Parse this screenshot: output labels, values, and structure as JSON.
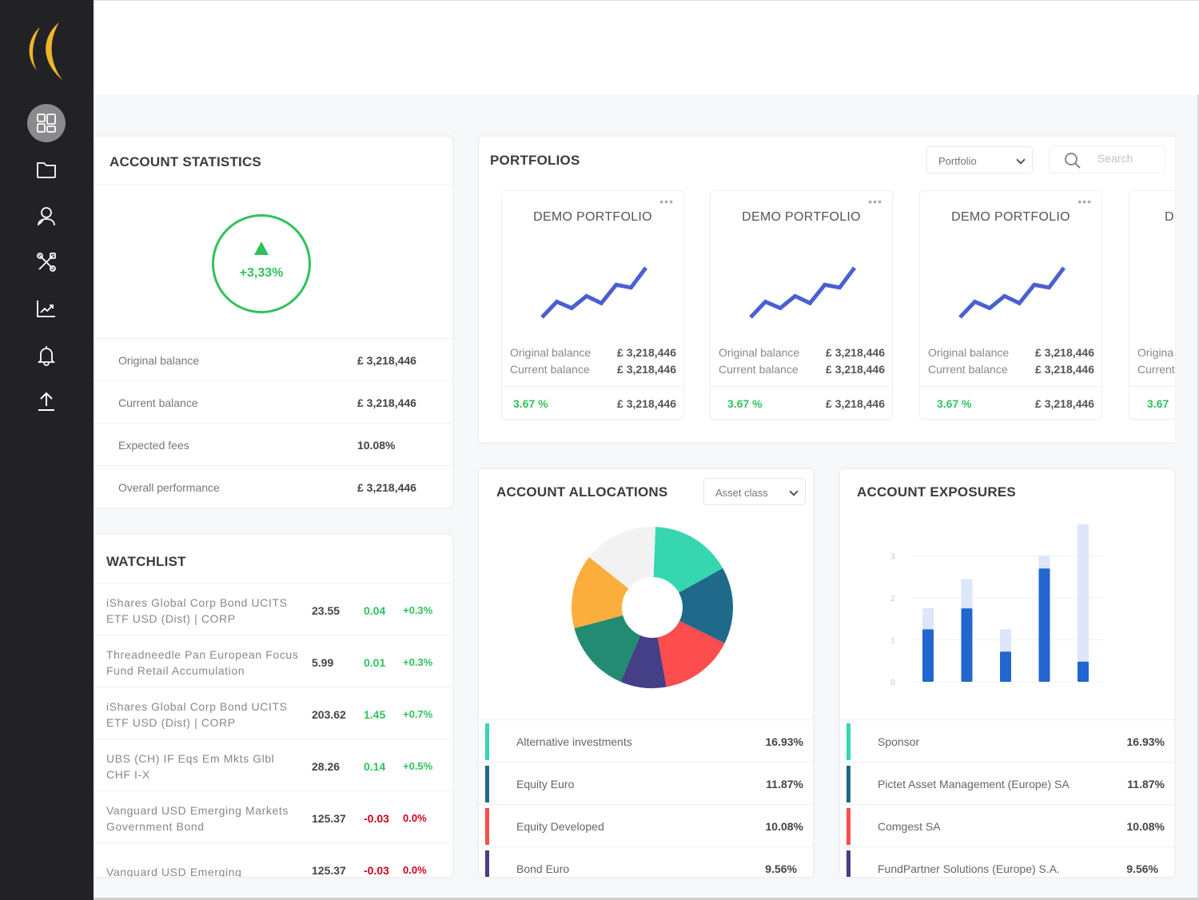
{
  "sidebar": {
    "logo": "brand-logo",
    "items": [
      {
        "name": "dashboard",
        "icon": "dashboard-icon",
        "active": true
      },
      {
        "name": "folder",
        "icon": "folder-icon",
        "active": false
      },
      {
        "name": "clients",
        "icon": "user-icon",
        "active": false
      },
      {
        "name": "tools",
        "icon": "tools-icon",
        "active": false
      },
      {
        "name": "analytics",
        "icon": "chart-icon",
        "active": false
      },
      {
        "name": "notifications",
        "icon": "bell-icon",
        "active": false
      },
      {
        "name": "upload",
        "icon": "upload-icon",
        "active": false
      }
    ]
  },
  "colors": {
    "green": "#2fc25b",
    "red": "#d0021b",
    "sparkline": "#4a5fd1",
    "bar_dark": "#2266d0",
    "bar_light": "#dde6fa",
    "sidebar_bg": "#222226",
    "logo": "#f0b428"
  },
  "account_statistics": {
    "title": "ACCOUNT STATISTICS",
    "performance": "+3,33%",
    "rows": [
      {
        "label": "Original balance",
        "value": "£ 3,218,446"
      },
      {
        "label": "Current balance",
        "value": "£ 3,218,446"
      },
      {
        "label": "Expected fees",
        "value": "10.08%"
      },
      {
        "label": "Overall performance",
        "value": "£ 3,218,446"
      }
    ]
  },
  "watchlist": {
    "title": "WATCHLIST",
    "rows": [
      {
        "name": "iShares Global Corp Bond UCITS ETF USD (Dist) | CORP",
        "price": "23.55",
        "change": "0.04",
        "pct": "+0.3%",
        "dir": "up"
      },
      {
        "name": "Threadneedle Pan European Focus Fund Retail Accumulation",
        "price": "5.99",
        "change": "0.01",
        "pct": "+0.3%",
        "dir": "up"
      },
      {
        "name": "iShares Global Corp Bond UCITS ETF USD (Dist) | CORP",
        "price": "203.62",
        "change": "1.45",
        "pct": "+0.7%",
        "dir": "up"
      },
      {
        "name": "UBS (CH) IF Eqs Em Mkts Glbl CHF I-X",
        "price": "28.26",
        "change": "0.14",
        "pct": "+0.5%",
        "dir": "up"
      },
      {
        "name": "Vanguard USD Emerging Markets Government Bond",
        "price": "125.37",
        "change": "-0.03",
        "pct": "0.0%",
        "dir": "down"
      },
      {
        "name": "Vanguard USD Emerging",
        "price": "125.37",
        "change": "-0.03",
        "pct": "0.0%",
        "dir": "down"
      }
    ]
  },
  "portfolios": {
    "title": "PORTFOLIOS",
    "filter": {
      "selected": "Portfolio"
    },
    "search": {
      "placeholder": "Search",
      "value": ""
    },
    "cards": [
      {
        "title": "DEMO PORTFOLIO",
        "original_label": "Original balance",
        "original": "£ 3,218,446",
        "current_label": "Current balance",
        "current": "£ 3,218,446",
        "pct": "3.67 %",
        "total": "£ 3,218,446",
        "trend": [
          0,
          2.2,
          1.3,
          3.0,
          2.0,
          4.6,
          4.2,
          7.0
        ]
      },
      {
        "title": "DEMO PORTFOLIO",
        "original_label": "Original balance",
        "original": "£ 3,218,446",
        "current_label": "Current balance",
        "current": "£ 3,218,446",
        "pct": "3.67 %",
        "total": "£ 3,218,446",
        "trend": [
          0,
          2.2,
          1.3,
          3.0,
          2.0,
          4.6,
          4.2,
          7.0
        ]
      },
      {
        "title": "DEMO PORTFOLIO",
        "original_label": "Original balance",
        "original": "£ 3,218,446",
        "current_label": "Current balance",
        "current": "£ 3,218,446",
        "pct": "3.67 %",
        "total": "£ 3,218,446",
        "trend": [
          0,
          2.2,
          1.3,
          3.0,
          2.0,
          4.6,
          4.2,
          7.0
        ]
      },
      {
        "title": "D",
        "original_label": "Origina",
        "original": "",
        "current_label": "Current",
        "current": "",
        "pct": "3.67",
        "total": "",
        "trend": []
      }
    ]
  },
  "account_allocations": {
    "title": "ACCOUNT ALLOCATIONS",
    "filter": {
      "selected": "Asset class"
    },
    "legend": [
      {
        "label": "Alternative investments",
        "value": "16.93%",
        "color": "#36d7b0"
      },
      {
        "label": "Equity Euro",
        "value": "11.87%",
        "color": "#1f6a8a"
      },
      {
        "label": "Equity Developed",
        "value": "10.08%",
        "color": "#fb4d4d"
      },
      {
        "label": "Bond Euro",
        "value": "9.56%",
        "color": "#443f86"
      }
    ]
  },
  "account_exposures": {
    "title": "ACCOUNT EXPOSURES",
    "legend": [
      {
        "label": "Sponsor",
        "value": "16.93%",
        "color": "#36d7b0"
      },
      {
        "label": "Pictet Asset Management (Europe) SA",
        "value": "11.87%",
        "color": "#1f6a8a"
      },
      {
        "label": "Comgest SA",
        "value": "10.08%",
        "color": "#fb4d4d"
      },
      {
        "label": "FundPartner Solutions (Europe) S.A.",
        "value": "9.56%",
        "color": "#443f86"
      }
    ]
  },
  "chart_data": [
    {
      "type": "pie",
      "title": "ACCOUNT ALLOCATIONS",
      "donut": true,
      "slices": [
        {
          "label": "Alternative investments",
          "value": 16.93,
          "color": "#36d7b0"
        },
        {
          "label": "Equity Euro",
          "value": 16.0,
          "color": "#1f6a8a"
        },
        {
          "label": "Equity Developed",
          "value": 15.5,
          "color": "#fb4d4d"
        },
        {
          "label": "Bond Euro",
          "value": 9.56,
          "color": "#443f86"
        },
        {
          "label": "Other green",
          "value": 15.0,
          "color": "#238b72"
        },
        {
          "label": "Other orange",
          "value": 15.5,
          "color": "#fcae3c"
        },
        {
          "label": "Other grey",
          "value": 15.5,
          "color": "#f2f2f3"
        }
      ]
    },
    {
      "type": "bar",
      "title": "ACCOUNT EXPOSURES",
      "stacked_overlay": true,
      "categories": [
        "1",
        "2",
        "3",
        "4",
        "5"
      ],
      "series": [
        {
          "name": "current",
          "values": [
            1.25,
            1.75,
            0.72,
            2.7,
            0.48
          ],
          "color": "#2266d0"
        },
        {
          "name": "target",
          "values": [
            1.75,
            2.45,
            1.25,
            3.0,
            3.75
          ],
          "color": "#dde6fa"
        }
      ],
      "yticks": [
        "0",
        "1",
        "2",
        "3"
      ],
      "ylim": [
        0,
        3.75
      ],
      "grid": true
    }
  ]
}
